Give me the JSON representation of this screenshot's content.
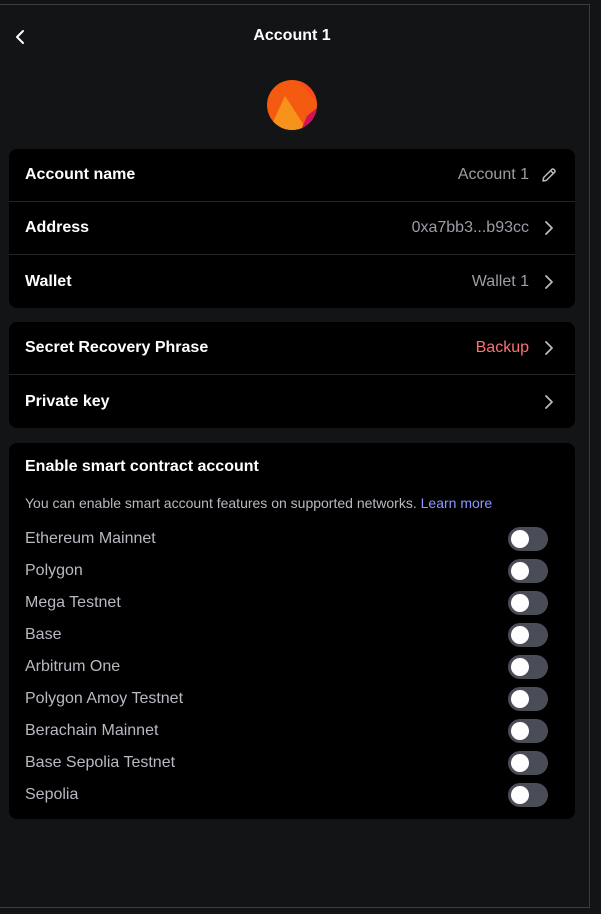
{
  "header": {
    "title": "Account 1"
  },
  "account_card": {
    "rows": [
      {
        "label": "Account name",
        "value": "Account 1",
        "icon": "pencil-icon"
      },
      {
        "label": "Address",
        "value": "0xa7bb3...b93cc",
        "icon": "chevron-right-icon"
      },
      {
        "label": "Wallet",
        "value": "Wallet 1",
        "icon": "chevron-right-icon"
      }
    ]
  },
  "security_card": {
    "rows": [
      {
        "label": "Secret Recovery Phrase",
        "value": "Backup",
        "icon": "chevron-right-icon"
      },
      {
        "label": "Private key",
        "value": "",
        "icon": "chevron-right-icon"
      }
    ]
  },
  "smart_account": {
    "title": "Enable smart contract account",
    "description": "You can enable smart account features on supported networks. ",
    "learn_more": "Learn more",
    "networks": [
      {
        "name": "Ethereum Mainnet",
        "enabled": false
      },
      {
        "name": "Polygon",
        "enabled": false
      },
      {
        "name": "Mega Testnet",
        "enabled": false
      },
      {
        "name": "Base",
        "enabled": false
      },
      {
        "name": "Arbitrum One",
        "enabled": false
      },
      {
        "name": "Polygon Amoy Testnet",
        "enabled": false
      },
      {
        "name": "Berachain Mainnet",
        "enabled": false
      },
      {
        "name": "Base Sepolia Testnet",
        "enabled": false
      },
      {
        "name": "Sepolia",
        "enabled": false
      }
    ]
  },
  "colors": {
    "background": "#131416",
    "card": "#000000",
    "danger": "#ff7070",
    "link": "#8b99ff",
    "toggle_off": "#4a4d57"
  }
}
